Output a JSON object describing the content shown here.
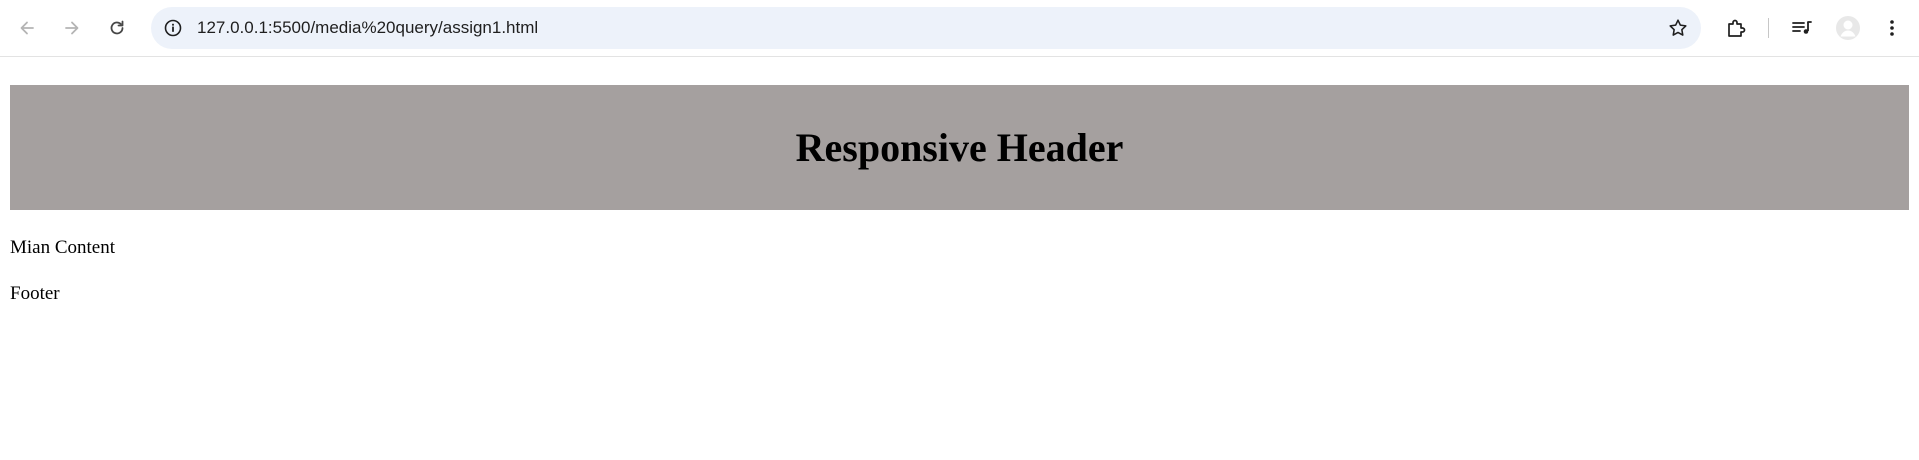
{
  "browser": {
    "url": "127.0.0.1:5500/media%20query/assign1.html",
    "icons": {
      "back": "arrow-left-icon",
      "forward": "arrow-right-icon",
      "reload": "reload-icon",
      "site_info": "info-icon",
      "bookmark": "star-icon",
      "extensions": "puzzle-icon",
      "media": "playlist-icon",
      "profile": "avatar-icon",
      "menu": "kebab-menu-icon"
    },
    "omnibox_color": "#edf2fa"
  },
  "page": {
    "header": {
      "title": "Responsive Header",
      "background": "#a5a09f"
    },
    "main": {
      "text": "Mian Content"
    },
    "footer": {
      "text": "Footer"
    }
  }
}
